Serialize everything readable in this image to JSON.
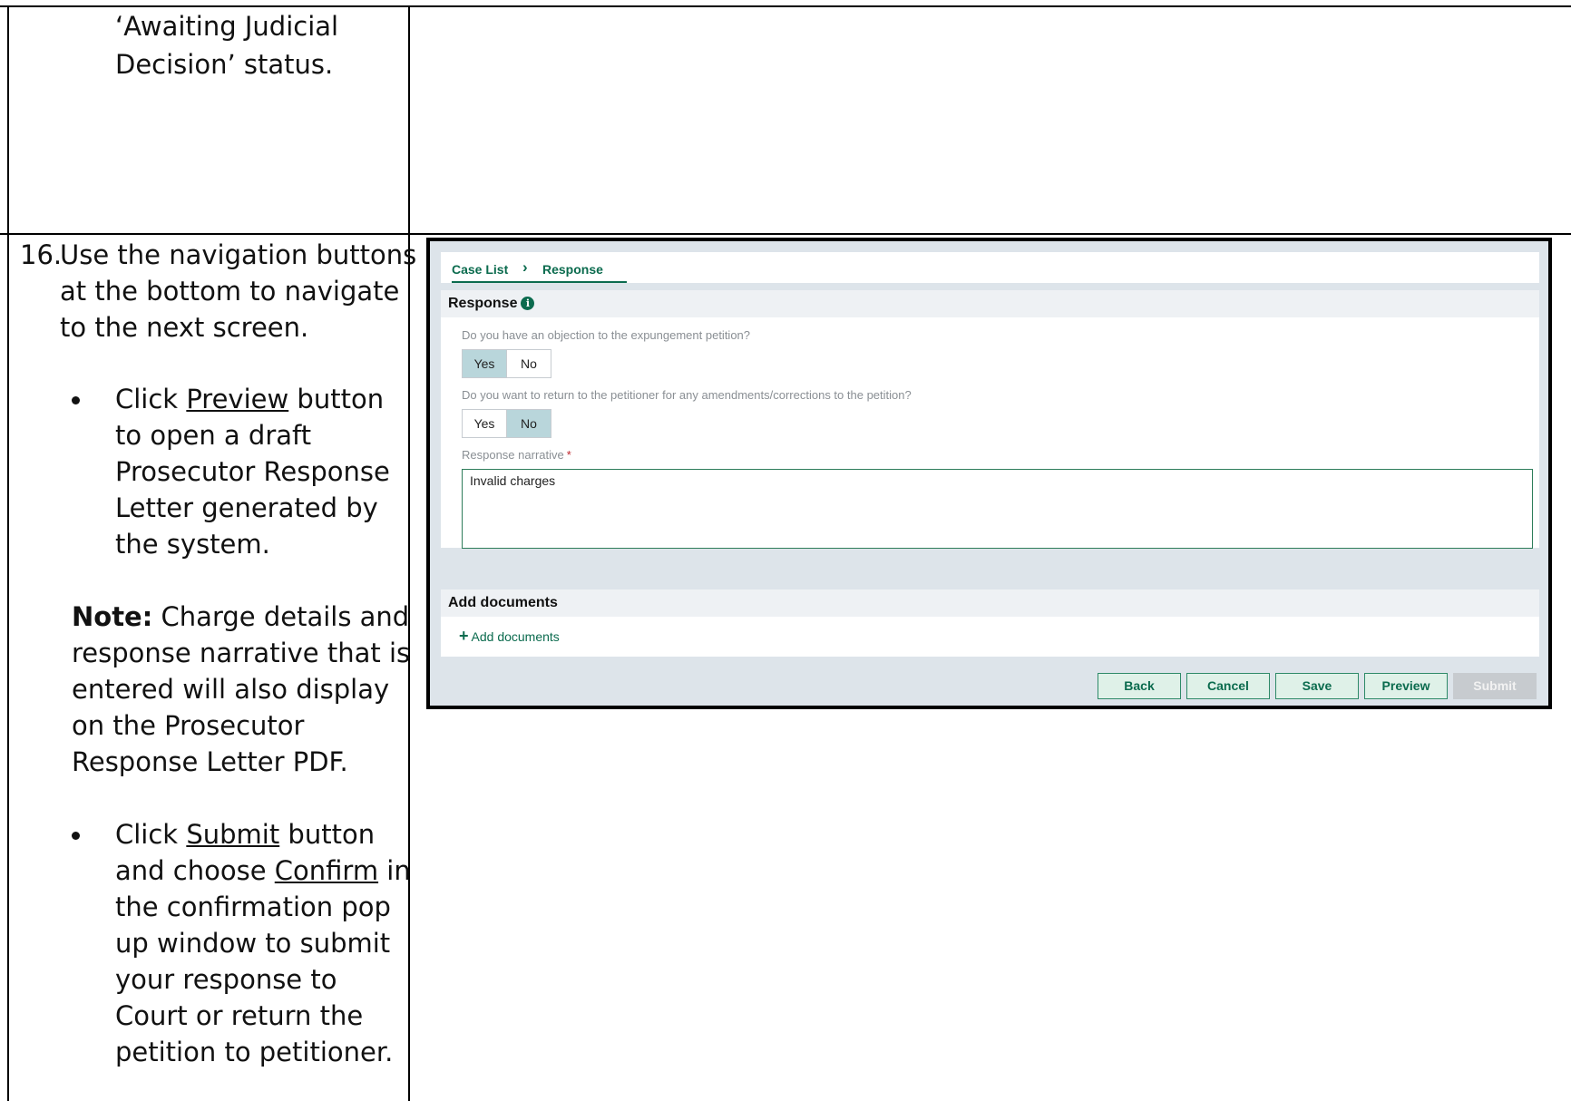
{
  "top_row": {
    "text_line1": "‘Awaiting Judicial",
    "text_line2": "Decision’ status."
  },
  "step": {
    "number": "16.",
    "intro_lines": [
      "Use the navigation buttons",
      "at the bottom to navigate",
      "to the next screen."
    ],
    "bullet1": {
      "prefix": "Click ",
      "link": "Preview",
      "suffix": " button",
      "lines": [
        "to open a draft",
        "Prosecutor Response",
        "Letter generated by",
        "the system."
      ]
    },
    "note": {
      "label": "Note:",
      "first_line_rest": " Charge details and",
      "lines": [
        "response narrative that is",
        "entered will also display",
        "on the Prosecutor",
        "Response Letter PDF."
      ]
    },
    "bullet2": {
      "prefix": "Click ",
      "link": "Submit",
      "suffix": " button",
      "line2_prefix": "and choose ",
      "line2_link": "Confirm",
      "line2_suffix": " in",
      "lines": [
        "the confirmation pop",
        "up window to submit",
        "your response to",
        "Court or return the",
        "petition to petitioner."
      ]
    }
  },
  "screenshot": {
    "breadcrumb": {
      "item1": "Case List",
      "separator": "›",
      "item2": "Response"
    },
    "response_section": {
      "title": "Response",
      "q1": "Do you have an objection to the expungement petition?",
      "q1_options": [
        "Yes",
        "No"
      ],
      "q1_selected": "Yes",
      "q2": "Do you want to return to the petitioner for any amendments/corrections to the petition?",
      "q2_options": [
        "Yes",
        "No"
      ],
      "q2_selected": "No",
      "narrative_label": "Response narrative",
      "required_marker": "*",
      "narrative_value": "Invalid charges"
    },
    "documents_section": {
      "title": "Add documents",
      "add_link": "Add documents",
      "add_icon": "plus-icon"
    },
    "buttons": {
      "back": "Back",
      "cancel": "Cancel",
      "save": "Save",
      "preview": "Preview",
      "submit": "Submit"
    },
    "colors": {
      "accent": "#0b6b4e",
      "selected_segment": "#b9d6db",
      "button_bg": "#dff1e8",
      "disabled_button": "#c7cbcf",
      "required": "#c0262d"
    }
  }
}
